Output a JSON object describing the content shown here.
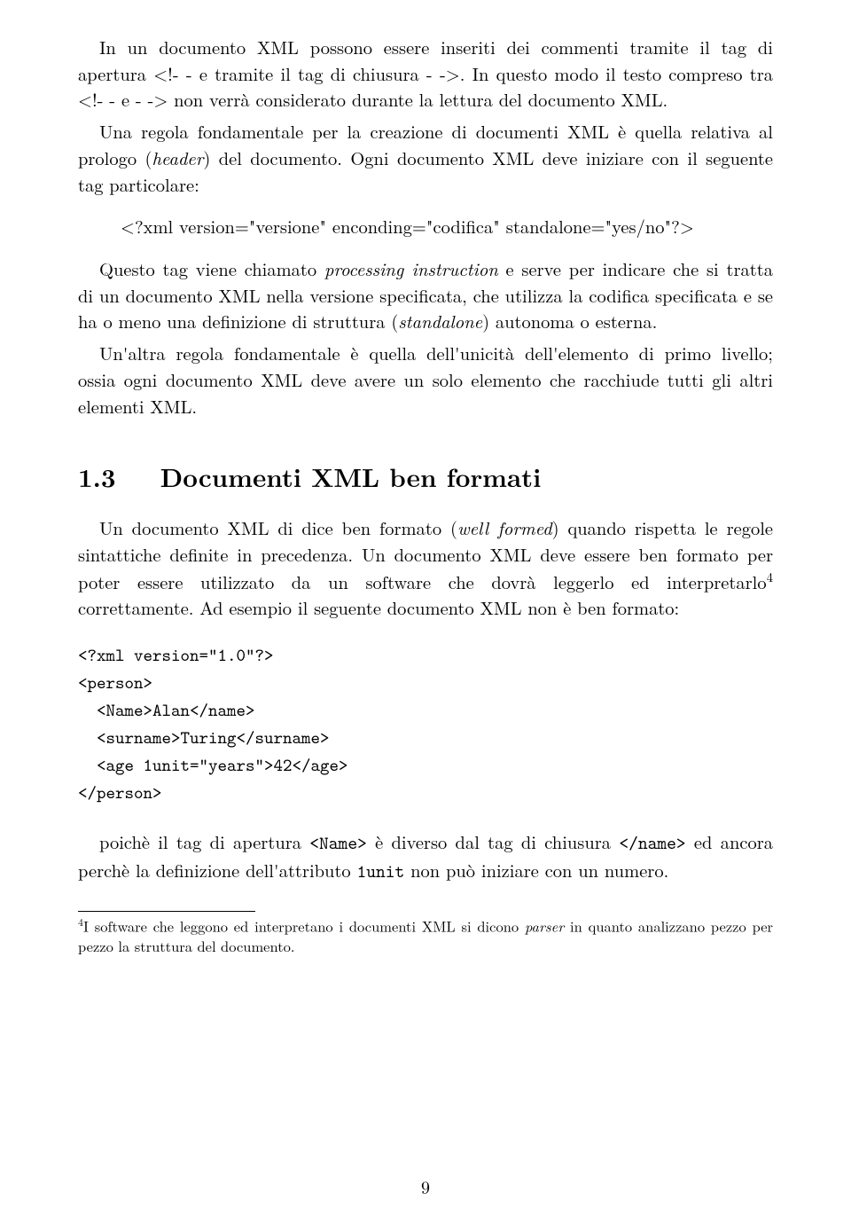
{
  "p1": {
    "a": "In un documento XML possono essere inseriti dei commenti tramite il tag di apertura <!- - e tramite il tag di chiusura - ->. In questo modo il testo compreso tra <!- - e - -> non verrà considerato durante la lettura del documento XML."
  },
  "p2": {
    "a": "Una regola fondamentale per la creazione di documenti XML è quella relativa al prologo (",
    "b": "header",
    "c": ") del documento. Ogni documento XML deve iniziare con il seguente tag particolare:"
  },
  "p_pi": "<?xml version=\"versione\" enconding=\"codifica\" standalone=\"yes/no\"?>",
  "p3": {
    "a": "Questo tag viene chiamato ",
    "b": "processing instruction",
    "c": " e serve per indicare che si tratta di un documento XML nella versione specificata, che utilizza la codifica specificata e se ha o meno una definizione di struttura (",
    "d": "standalone",
    "e": ") autonoma o esterna."
  },
  "p4": "Un'altra regola fondamentale è quella dell'unicità dell'elemento di primo livello; ossia ogni documento XML deve avere un solo elemento che racchiude tutti gli altri elementi XML.",
  "section_number": "1.3",
  "section_title": "Documenti XML ben formati",
  "p5": {
    "a": "Un documento XML di dice ben formato (",
    "b": "well formed",
    "c": ") quando rispetta le regole sintattiche definite in precedenza. Un documento XML deve essere ben formato per poter essere utilizzato da un software che dovrà leggerlo ed interpretarlo",
    "fn": "4",
    "d": " correttamente. Ad esempio il seguente documento XML non è ben formato:"
  },
  "code": "<?xml version=\"1.0\"?>\n<person>\n  <Name>Alan</name>\n  <surname>Turing</surname>\n  <age 1unit=\"years\">42</age>\n</person>",
  "p6": {
    "a": "poichè il tag di apertura ",
    "b": "<Name>",
    "c": " è diverso dal tag di chiusura ",
    "d": "</name>",
    "e": " ed ancora perchè la definizione dell'attributo ",
    "f": "1unit",
    "g": " non può iniziare con un numero."
  },
  "footnote": {
    "num": "4",
    "a": "I software che leggono ed interpretano i documenti XML si dicono ",
    "b": "parser",
    "c": " in quanto analizzano pezzo per pezzo la struttura del documento."
  },
  "page_number": "9"
}
